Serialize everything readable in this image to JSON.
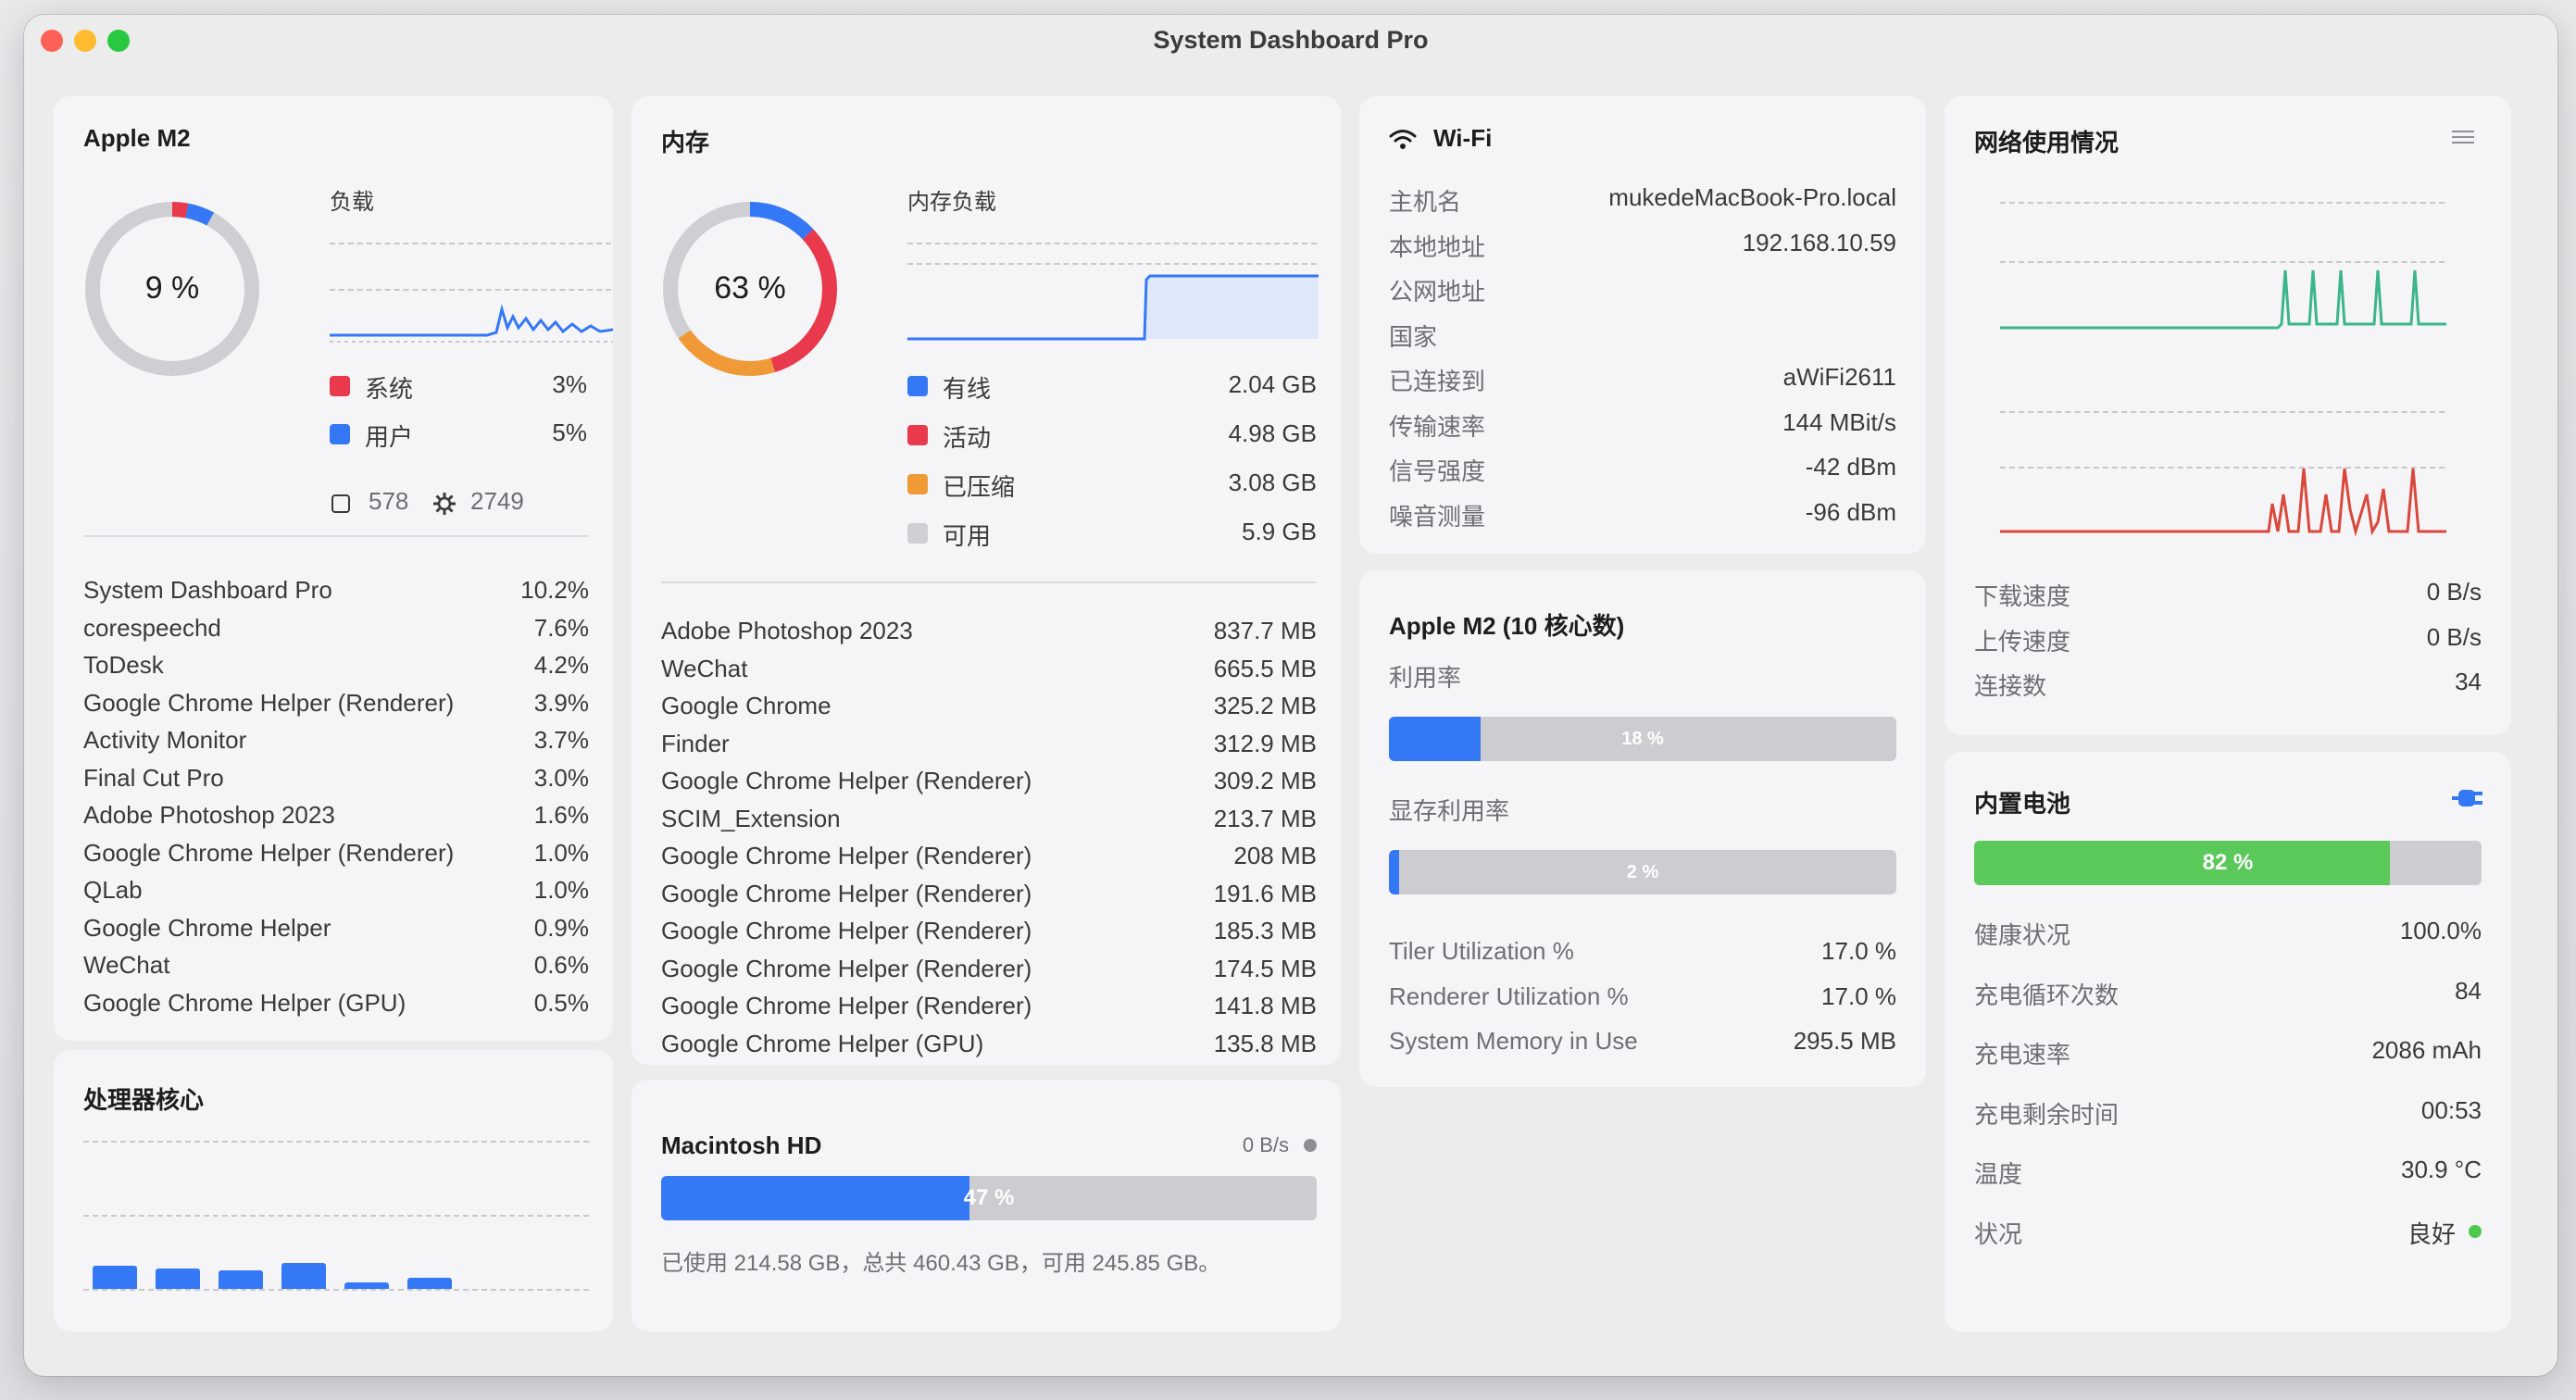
{
  "window": {
    "title": "System Dashboard Pro"
  },
  "cpu": {
    "title": "Apple M2",
    "percent": "9 %",
    "load_label": "负载",
    "system_label": "系统",
    "system_value": "3%",
    "user_label": "用户",
    "user_value": "5%",
    "threads": "578",
    "processes_count": "2749",
    "processes": [
      {
        "name": "System Dashboard Pro",
        "value": "10.2%"
      },
      {
        "name": "corespeechd",
        "value": "7.6%"
      },
      {
        "name": "ToDesk",
        "value": "4.2%"
      },
      {
        "name": "Google Chrome Helper (Renderer)",
        "value": "3.9%"
      },
      {
        "name": "Activity Monitor",
        "value": "3.7%"
      },
      {
        "name": "Final Cut Pro",
        "value": "3.0%"
      },
      {
        "name": "Adobe Photoshop 2023",
        "value": "1.6%"
      },
      {
        "name": "Google Chrome Helper (Renderer)",
        "value": "1.0%"
      },
      {
        "name": "QLab",
        "value": "1.0%"
      },
      {
        "name": "Google Chrome Helper",
        "value": "0.9%"
      },
      {
        "name": "WeChat",
        "value": "0.6%"
      },
      {
        "name": "Google Chrome Helper (GPU)",
        "value": "0.5%"
      }
    ],
    "colors": {
      "system": "#e8394d",
      "user": "#3478f6"
    }
  },
  "cores": {
    "title": "处理器核心",
    "levels": [
      0.45,
      0.4,
      0.35,
      0.5,
      0.12,
      0.22
    ]
  },
  "memory": {
    "title": "内存",
    "percent": "63 %",
    "load_label": "内存负载",
    "legend": [
      {
        "label": "有线",
        "value": "2.04 GB",
        "color": "#3478f6"
      },
      {
        "label": "活动",
        "value": "4.98 GB",
        "color": "#e8394d"
      },
      {
        "label": "已压缩",
        "value": "3.08 GB",
        "color": "#f09a37"
      },
      {
        "label": "可用",
        "value": "5.9 GB",
        "color": "#d0d0d4"
      }
    ],
    "processes": [
      {
        "name": "Adobe Photoshop 2023",
        "value": "837.7 MB"
      },
      {
        "name": "WeChat",
        "value": "665.5 MB"
      },
      {
        "name": "Google Chrome",
        "value": "325.2 MB"
      },
      {
        "name": "Finder",
        "value": "312.9 MB"
      },
      {
        "name": "Google Chrome Helper (Renderer)",
        "value": "309.2 MB"
      },
      {
        "name": "SCIM_Extension",
        "value": "213.7 MB"
      },
      {
        "name": "Google Chrome Helper (Renderer)",
        "value": "208 MB"
      },
      {
        "name": "Google Chrome Helper (Renderer)",
        "value": "191.6 MB"
      },
      {
        "name": "Google Chrome Helper (Renderer)",
        "value": "185.3 MB"
      },
      {
        "name": "Google Chrome Helper (Renderer)",
        "value": "174.5 MB"
      },
      {
        "name": "Google Chrome Helper (Renderer)",
        "value": "141.8 MB"
      },
      {
        "name": "Google Chrome Helper (GPU)",
        "value": "135.8 MB"
      }
    ]
  },
  "disk": {
    "title": "Macintosh HD",
    "speed": "0 B/s",
    "percent_label": "47 %",
    "percent": 0.47,
    "summary": "已使用 214.58 GB，总共 460.43 GB，可用 245.85 GB。"
  },
  "wifi": {
    "title": "Wi-Fi",
    "icon": "wifi-icon",
    "rows": [
      {
        "label": "主机名",
        "value": "mukedeMacBook-Pro.local"
      },
      {
        "label": "本地地址",
        "value": "192.168.10.59"
      },
      {
        "label": "公网地址",
        "value": ""
      },
      {
        "label": "国家",
        "value": ""
      },
      {
        "label": "已连接到",
        "value": "aWiFi2611"
      },
      {
        "label": "传输速率",
        "value": "144 MBit/s"
      },
      {
        "label": "信号强度",
        "value": "-42 dBm"
      },
      {
        "label": "噪音测量",
        "value": "-96 dBm"
      }
    ]
  },
  "gpu": {
    "title": "Apple M2 (10 核心数)",
    "util_label": "利用率",
    "util_text": "18 %",
    "util": 0.18,
    "vram_label": "显存利用率",
    "vram_text": "2 %",
    "vram": 0.02,
    "rows": [
      {
        "label": "Tiler Utilization %",
        "value": "17.0 %"
      },
      {
        "label": "Renderer Utilization %",
        "value": "17.0 %"
      },
      {
        "label": "System Memory in Use",
        "value": "295.5 MB"
      }
    ]
  },
  "network": {
    "title": "网络使用情况",
    "rows": [
      {
        "label": "下载速度",
        "value": "0 B/s"
      },
      {
        "label": "上传速度",
        "value": "0 B/s"
      },
      {
        "label": "连接数",
        "value": "34"
      }
    ],
    "colors": {
      "download": "#3cb58a",
      "upload": "#d9483b"
    }
  },
  "battery": {
    "title": "内置电池",
    "percent_text": "82 %",
    "percent": 0.82,
    "rows": [
      {
        "label": "健康状况",
        "value": "100.0%"
      },
      {
        "label": "充电循环次数",
        "value": "84"
      },
      {
        "label": "充电速率",
        "value": "2086 mAh"
      },
      {
        "label": "充电剩余时间",
        "value": "00:53"
      },
      {
        "label": "温度",
        "value": "30.9 °C"
      },
      {
        "label": "状况",
        "value": "良好"
      }
    ],
    "colors": {
      "fill": "#5bc85a",
      "status": "#4cc94a",
      "plug": "#3478f6"
    }
  }
}
